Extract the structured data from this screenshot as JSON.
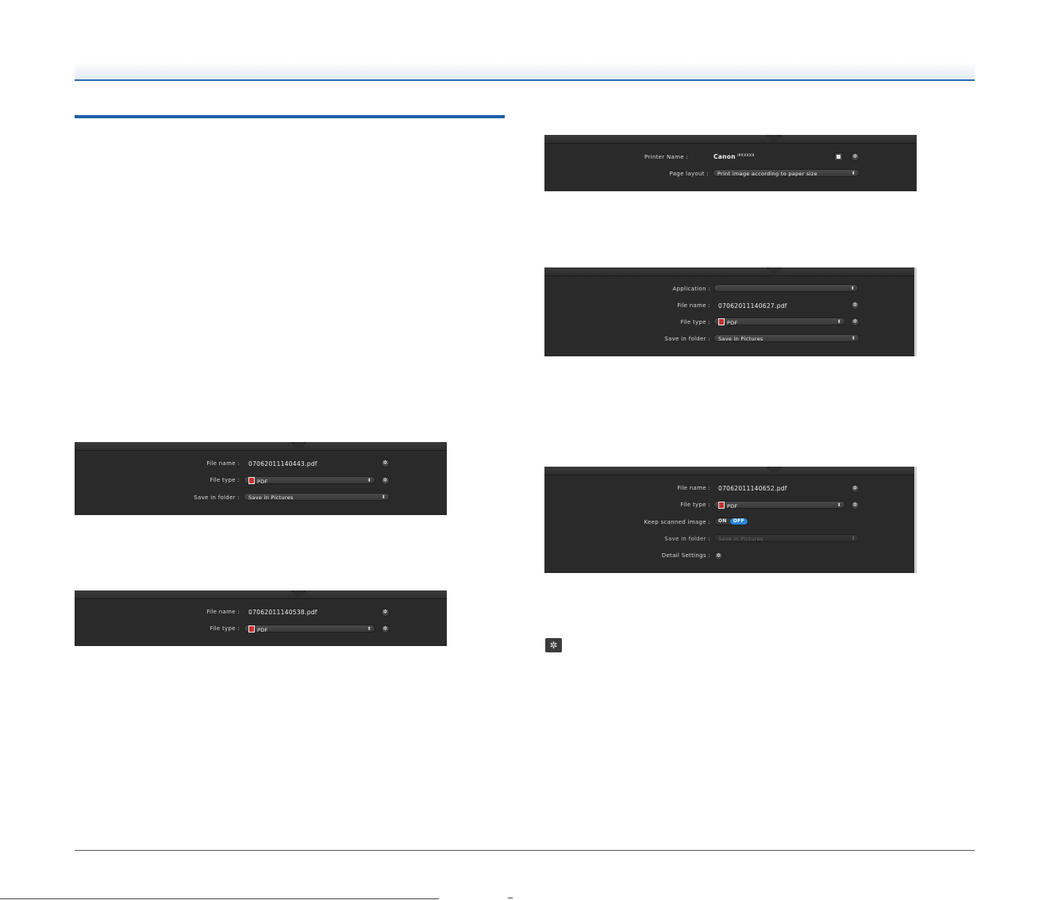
{
  "panel_print": {
    "printer_label": "Printer Name :",
    "printer_value": "Canon",
    "printer_model": "iPXXXXX",
    "layout_label": "Page layout :",
    "layout_value": "Print image according to paper size"
  },
  "panel_app": {
    "app_label": "Application :",
    "app_value": "",
    "filename_label": "File name :",
    "filename_value": "07062011140627.pdf",
    "filetype_label": "File type :",
    "filetype_value": "PDF",
    "folder_label": "Save in folder :",
    "folder_value": "Save in Pictures"
  },
  "panel_folder": {
    "filename_label": "File name :",
    "filename_value": "07062011140443.pdf",
    "filetype_label": "File type :",
    "filetype_value": "PDF",
    "folder_label": "Save in folder :",
    "folder_value": "Save in Pictures"
  },
  "panel_mail": {
    "filename_label": "File name :",
    "filename_value": "07062011140538.pdf",
    "filetype_label": "File type :",
    "filetype_value": "PDF"
  },
  "panel_ocr": {
    "filename_label": "File name :",
    "filename_value": "07062011140652.pdf",
    "filetype_label": "File type :",
    "filetype_value": "PDF",
    "keep_label": "Keep scanned image :",
    "toggle_on": "ON",
    "toggle_off": "OFF",
    "toggle_state": "OFF",
    "folder_label": "Save in folder :",
    "folder_value": "Save in Pictures",
    "detail_label": "Detail Settings :"
  },
  "icons": {
    "gear": "gear-icon",
    "select_arrows": "up-down-arrows-icon",
    "pdf": "pdf-file-icon",
    "printer_list": "document-icon"
  },
  "colors": {
    "accent_blue": "#1f5fa8",
    "panel_bg": "#2a2a2a",
    "toggle_off_blue": "#2a86d8",
    "pdf_red": "#c83232"
  }
}
